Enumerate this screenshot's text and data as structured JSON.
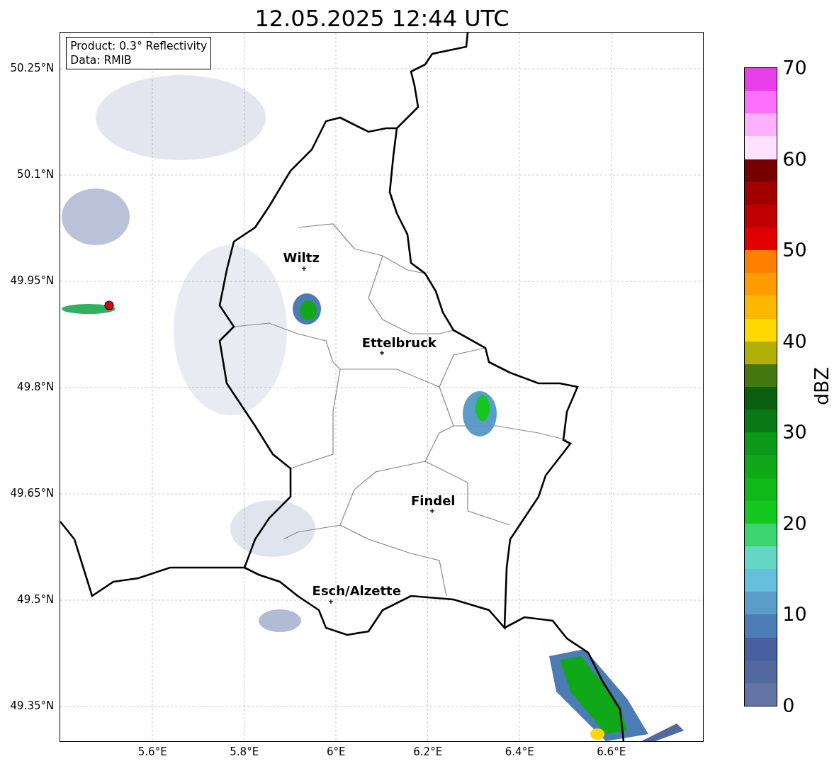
{
  "title": "12.05.2025 12:44 UTC",
  "legend": [
    "Product: 0.3° Reflectivity",
    "Data: RMIB"
  ],
  "y_ticks": [
    "50.25°N",
    "50.1°N",
    "49.95°N",
    "49.8°N",
    "49.65°N",
    "49.5°N",
    "49.35°N"
  ],
  "x_ticks": [
    "5.6°E",
    "5.8°E",
    "6°E",
    "6.2°E",
    "6.4°E",
    "6.6°E"
  ],
  "cities": [
    {
      "name": "Wiltz"
    },
    {
      "name": "Ettelbruck"
    },
    {
      "name": "Findel"
    },
    {
      "name": "Esch/Alzette"
    }
  ],
  "colorbar": {
    "label": "dBZ",
    "ticks": [
      "70",
      "60",
      "50",
      "40",
      "30",
      "20",
      "10",
      "0"
    ]
  }
}
